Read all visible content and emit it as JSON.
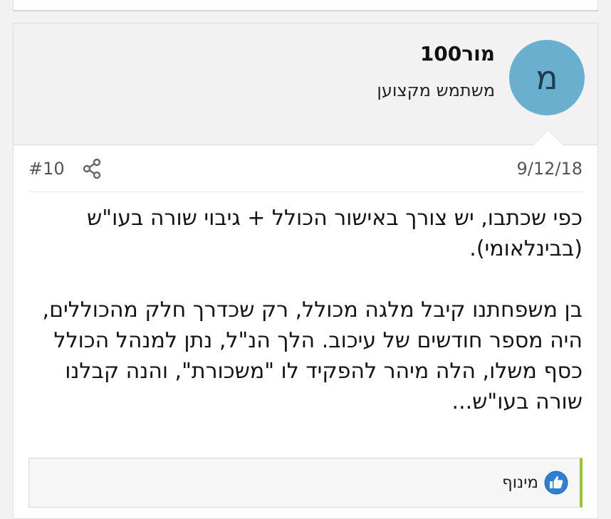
{
  "author": {
    "avatar_letter": "מ",
    "username": "מור100",
    "title": "משתמש מקצוען",
    "avatar_color": "#6aafcd"
  },
  "post": {
    "date": "9/12/18",
    "number": "#10",
    "paragraphs": [
      "כפי שכתבו, יש צורך באישור הכולל + גיבוי שורה בעו\"ש (בבינלאומי).",
      "בן משפחתנו קיבל מלגה מכולל, רק שכדרך חלק מהכוללים, היה מספר חודשים של עיכוב. הלך הנ\"ל, נתן למנהל הכולל כסף משלו, הלה מיהר להפקיד לו \"משכורת\", והנה קבלנו שורה בעו\"ש..."
    ]
  },
  "reactions": {
    "label": "מינוף",
    "icon": "thumbs-up-icon",
    "accent_color": "#9ac33c"
  },
  "icons": {
    "share": "share-icon"
  }
}
